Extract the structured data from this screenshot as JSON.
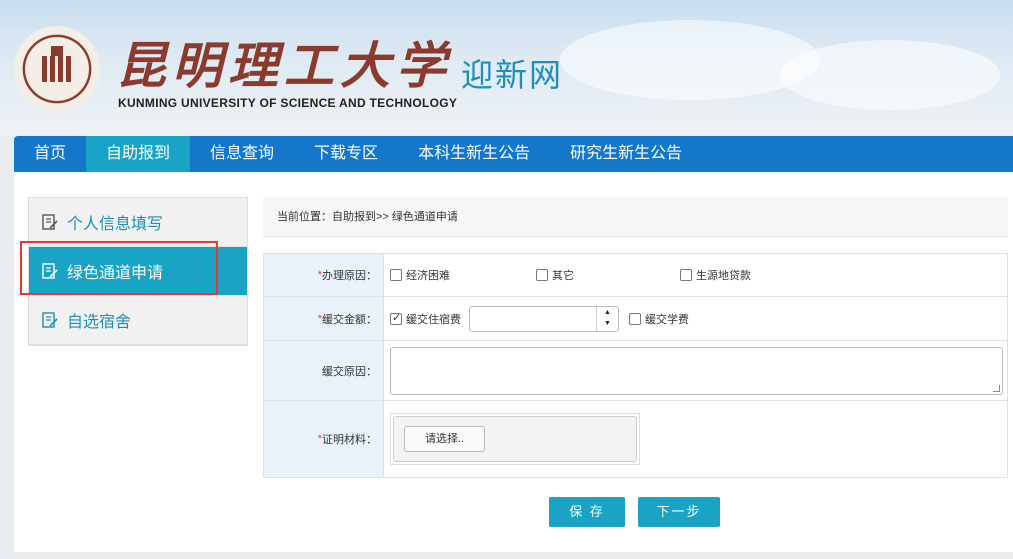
{
  "header": {
    "title_cn": "昆明理工大学",
    "title_en": "KUNMING UNIVERSITY OF SCIENCE AND TECHNOLOGY",
    "site_name": "迎新网"
  },
  "nav": {
    "items": [
      "首页",
      "自助报到",
      "信息查询",
      "下载专区",
      "本科生新生公告",
      "研究生新生公告"
    ],
    "active": "自助报到"
  },
  "sidebar": {
    "items": [
      {
        "label": "个人信息填写",
        "icon": "edit-icon"
      },
      {
        "label": "绿色通道申请",
        "icon": "edit-icon",
        "active": true
      },
      {
        "label": "自选宿舍",
        "icon": "edit-icon"
      }
    ]
  },
  "breadcrumb": "当前位置：自助报到>> 绿色通道申请",
  "form": {
    "reason": {
      "label": "办理原因：",
      "options": [
        "经济困难",
        "其它",
        "生源地贷款"
      ]
    },
    "amount": {
      "label": "缓交金额：",
      "option1": "缓交住宿费",
      "option1_checked": true,
      "input_value": "",
      "option2": "缓交学费"
    },
    "defer_reason": {
      "label": "缓交原因："
    },
    "proof": {
      "label": "证明材料：",
      "button": "请选择.."
    }
  },
  "actions": {
    "save": "保 存",
    "next": "下一步"
  },
  "colors": {
    "nav": "#1577c9",
    "accent": "#19a3c4",
    "brand": "#8a3b2d",
    "highlight": "#e53935"
  }
}
